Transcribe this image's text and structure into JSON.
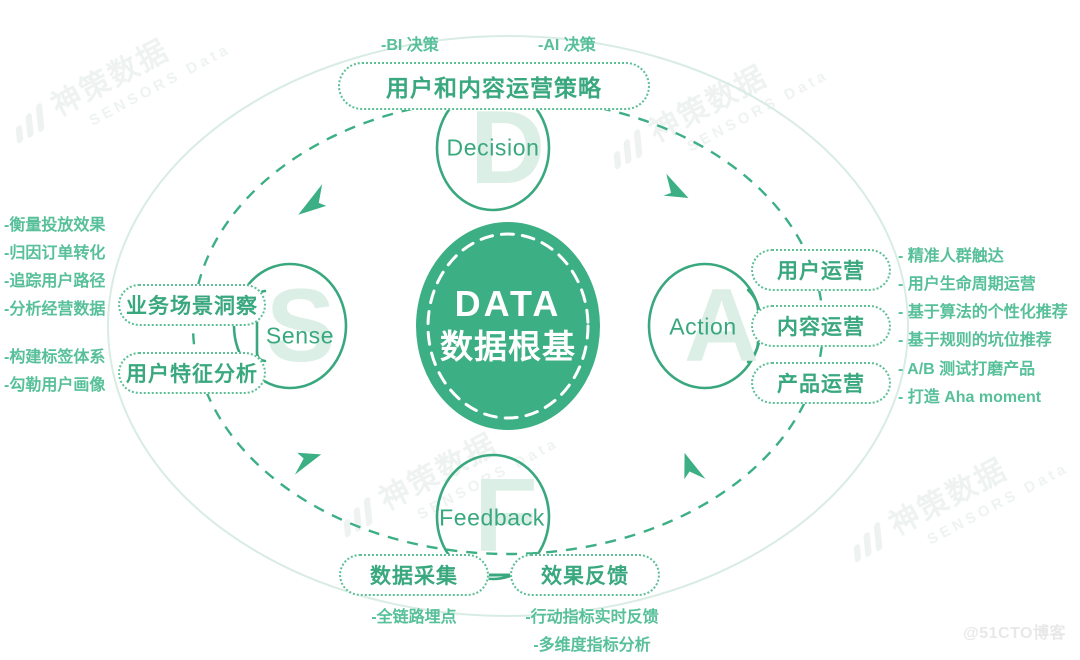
{
  "diagram": {
    "title_center_en": "DATA",
    "title_center_cn": "数据根基",
    "nodes": {
      "decision": {
        "label": "Decision",
        "ghost": "D"
      },
      "sense": {
        "label": "Sense",
        "ghost": "S"
      },
      "action": {
        "label": "Action",
        "ghost": "A"
      },
      "feedback": {
        "label": "Feedback",
        "ghost": "F"
      }
    },
    "decision_section": {
      "pill": "用户和内容运营策略",
      "tags": [
        "-BI 决策",
        "-AI 决策"
      ]
    },
    "sense_section": {
      "pills": [
        "业务场景洞察",
        "用户特征分析"
      ],
      "group_one": [
        "-衡量投放效果",
        "-归因订单转化",
        "-追踪用户路径",
        "-分析经营数据"
      ],
      "group_two": [
        "-构建标签体系",
        "-勾勒用户画像"
      ]
    },
    "action_section": {
      "rows": [
        {
          "pill": "用户运营",
          "details": [
            "- 精准人群触达",
            "- 用户生命周期运营"
          ]
        },
        {
          "pill": "内容运营",
          "details": [
            "- 基于算法的个性化推荐",
            "- 基于规则的坑位推荐"
          ]
        },
        {
          "pill": "产品运营",
          "details": [
            "- A/B 测试打磨产品",
            "- 打造 Aha moment"
          ]
        }
      ]
    },
    "feedback_section": {
      "pills": [
        "数据采集",
        "效果反馈"
      ],
      "left_details": [
        "-全链路埋点"
      ],
      "right_details": [
        "-行动指标实时反馈",
        "-多维度指标分析"
      ]
    },
    "watermarks": {
      "brand_cn": "神策数据",
      "brand_en": "SENSORS Data",
      "corner": "@51CTO博客"
    },
    "colors": {
      "primary": "#3aa87f",
      "fill": "#3daf84",
      "light": "#5cbf95",
      "ghost": "#dcefe6",
      "faint": "#d9ece4"
    }
  }
}
